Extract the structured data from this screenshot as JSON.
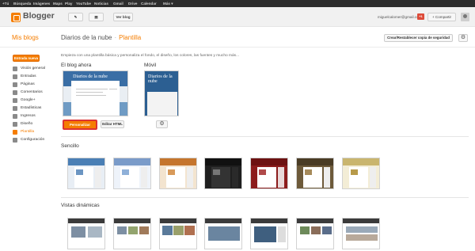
{
  "gbar": {
    "items": [
      "+Tú",
      "Búsqueda",
      "Imágenes",
      "Maps",
      "Play",
      "YouTube",
      "Noticias",
      "Gmail",
      "Drive",
      "Calendar",
      "Más"
    ]
  },
  "header": {
    "brand": "Blogger",
    "view_blog": "Ver blog",
    "email": "miguelcalomer@gmail.com",
    "share": "+ Compartir",
    "plusone": "+1"
  },
  "topbar": {
    "my_blogs": "Mis blogs",
    "blog_name": "Diarios de la nube",
    "section": "Plantilla",
    "reset_button": "Crear/Restablecer copia de seguridad"
  },
  "sidebar": {
    "new_post": "Entrada nueva",
    "items": [
      {
        "label": "Visión general",
        "icon": "home-icon"
      },
      {
        "label": "Entradas",
        "icon": "posts-icon"
      },
      {
        "label": "Páginas",
        "icon": "pages-icon"
      },
      {
        "label": "Comentarios",
        "icon": "comments-icon"
      },
      {
        "label": "Google+",
        "icon": "googleplus-icon"
      },
      {
        "label": "Estadísticas",
        "icon": "stats-icon"
      },
      {
        "label": "Ingresos",
        "icon": "earnings-icon"
      },
      {
        "label": "Diseño",
        "icon": "layout-icon"
      },
      {
        "label": "Plantilla",
        "icon": "template-icon",
        "active": true
      },
      {
        "label": "Configuración",
        "icon": "settings-icon"
      }
    ]
  },
  "main": {
    "intro": "Empieza con una plantilla básica y personaliza el fondo, el diseño, los colores, las fuentes y mucho más...",
    "live_heading": "El blog ahora",
    "mobile_heading": "Móvil",
    "live_thumb_title": "Diarios de la nube",
    "mobile_thumb_title": "Diarios de la nube",
    "customize_button": "Personalizar",
    "edit_html_button": "Editar HTML",
    "simple_heading": "Sencillo",
    "dynamic_heading": "Vistas dinámicas"
  },
  "colors": {
    "accent": "#f57d00",
    "simple_templates": [
      "#4a7fb5",
      "#7a9bc9",
      "#c5752d",
      "#1f1f1f",
      "#8c1c1c",
      "#6d5a3a",
      "#c9b56e",
      "#a7c48f"
    ]
  }
}
